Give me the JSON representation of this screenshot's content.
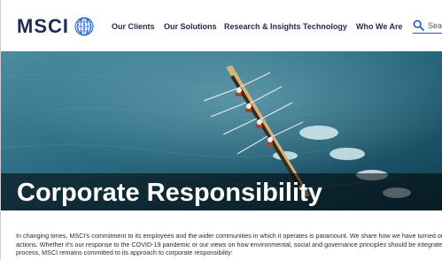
{
  "header": {
    "logo_text": "MSCI",
    "nav": [
      {
        "label": "Our Clients"
      },
      {
        "label": "Our Solutions"
      },
      {
        "label": "Research & Insights"
      },
      {
        "label": "Technology"
      },
      {
        "label": "Who We Are"
      }
    ],
    "search": {
      "placeholder": "Sear",
      "icon": "search-icon"
    }
  },
  "hero": {
    "title": "Corporate Responsibility",
    "image": "rowing-crew-on-water"
  },
  "intro": {
    "lines": [
      "In changing times, MSCI's commitment to its employees and the wider communities in which it operates is paramount. We share how we have turned our id",
      "actions. Whether it's our response to the COVID-19 pandemic or our views on how environmental, social and governance principles should be integrated into",
      "process, MSCI remains committed to its approach to corporate responsibility:"
    ]
  },
  "colors": {
    "brand": "#1f2a4d",
    "accent": "#1a5fd0",
    "water": "#1f5f74"
  }
}
